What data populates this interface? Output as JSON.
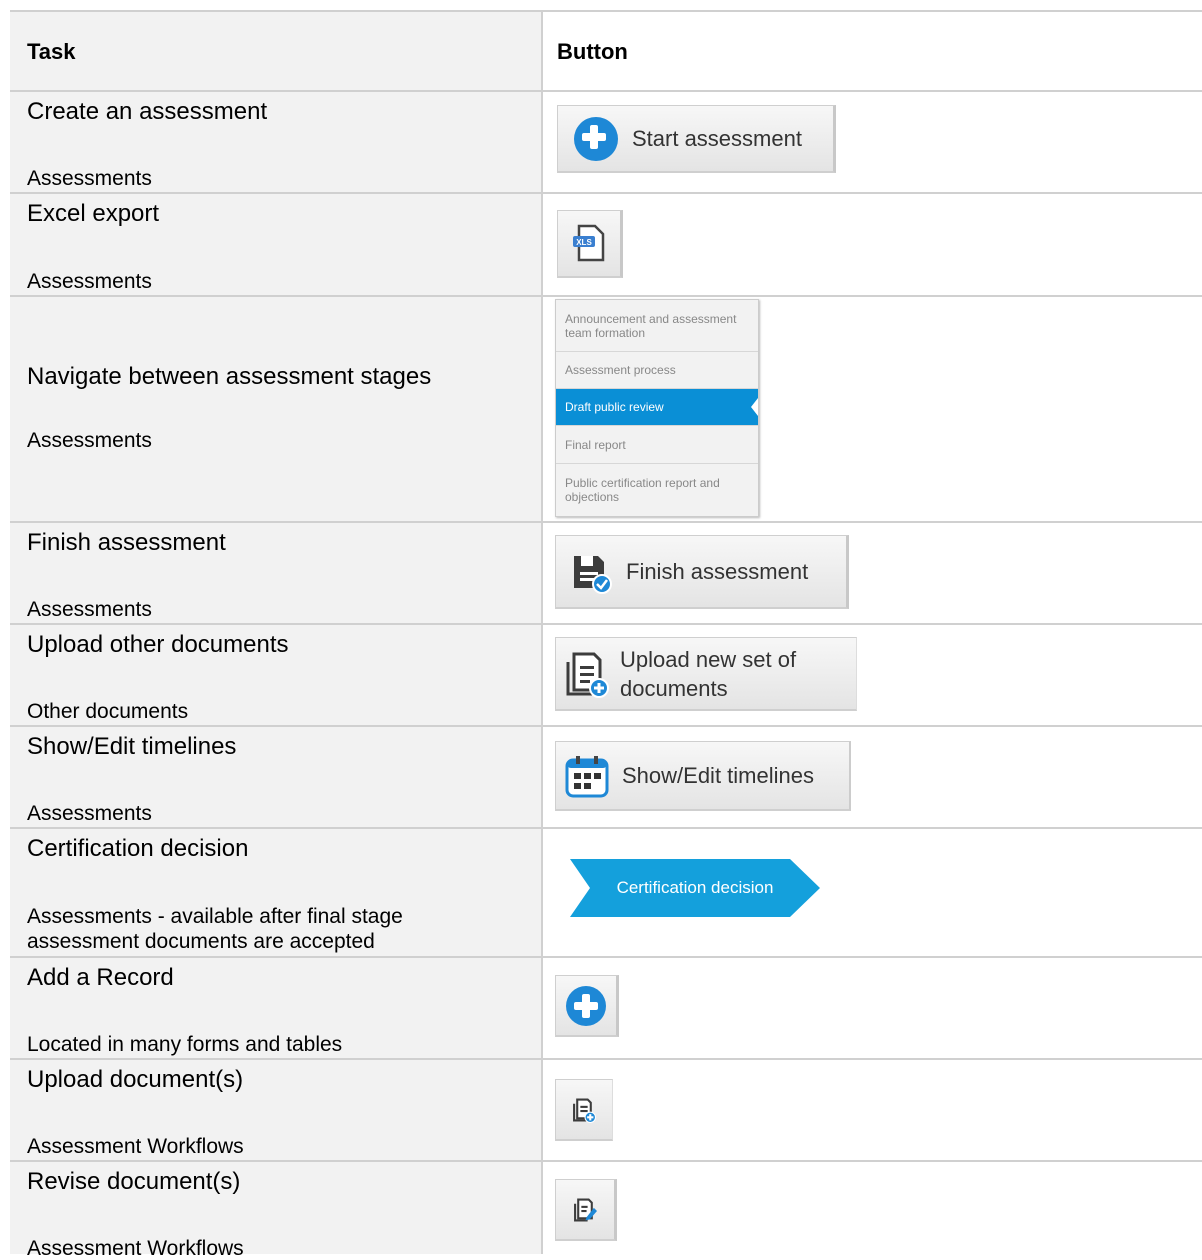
{
  "header": {
    "task": "Task",
    "button": "Button"
  },
  "rows": [
    {
      "title": "Create an assessment",
      "sub": "Assessments",
      "button": "Start assessment"
    },
    {
      "title": "Excel export",
      "sub": "Assessments",
      "button": "XLS"
    },
    {
      "title": "Navigate between assessment stages",
      "sub": "Assessments",
      "stages": [
        "Announcement and assessment team formation",
        "Assessment process",
        "Draft public review",
        "Final report",
        "Public certification report and objections"
      ],
      "active_stage": "Draft public review"
    },
    {
      "title": "Finish assessment",
      "sub": "Assessments",
      "button": "Finish assessment"
    },
    {
      "title": "Upload other documents",
      "sub": "Other documents",
      "button_line1": "Upload new set of",
      "button_line2": "documents"
    },
    {
      "title": "Show/Edit timelines",
      "sub": "Assessments",
      "button": "Show/Edit timelines"
    },
    {
      "title": "Certification decision",
      "sub_line1": "Assessments - available after final stage",
      "sub_line2": "assessment documents are accepted",
      "button": "Certification decision"
    },
    {
      "title": "Add a Record",
      "sub": "Located in many forms and tables"
    },
    {
      "title": "Upload document(s)",
      "sub": "Assessment Workflows"
    },
    {
      "title": "Revise document(s)",
      "sub": "Assessment Workflows"
    }
  ],
  "colors": {
    "accent": "#1e88d6",
    "active_stage": "#0a8fd6",
    "cert": "#14a0dc",
    "task_bg": "#f2f2f2",
    "border": "#d0d0d0"
  }
}
